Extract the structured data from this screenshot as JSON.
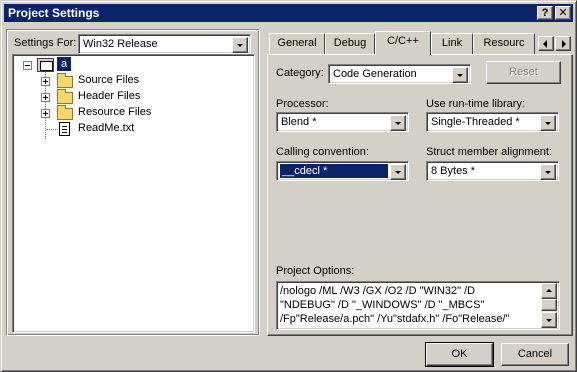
{
  "window": {
    "title": "Project Settings",
    "help_glyph": "?",
    "close_glyph": "✕"
  },
  "left": {
    "settings_for_label": "Settings For:",
    "settings_for_value": "Win32 Release",
    "tree": {
      "root": "a",
      "items": [
        {
          "label": "Source Files",
          "type": "folder"
        },
        {
          "label": "Header Files",
          "type": "folder"
        },
        {
          "label": "Resource Files",
          "type": "folder"
        },
        {
          "label": "ReadMe.txt",
          "type": "file"
        }
      ]
    }
  },
  "tabs": [
    "General",
    "Debug",
    "C/C++",
    "Link",
    "Resourc"
  ],
  "active_tab": "C/C++",
  "ccpp": {
    "category_label": "Category:",
    "category_value": "Code Generation",
    "reset_label": "Reset",
    "processor_label": "Processor:",
    "processor_value": "Blend *",
    "runtime_label": "Use run-time library:",
    "runtime_value": "Single-Threaded *",
    "calling_label": "Calling convention:",
    "calling_value": "__cdecl *",
    "struct_label": "Struct member alignment:",
    "struct_value": "8 Bytes *",
    "options_label": "Project Options:",
    "options_text": "/nologo /ML /W3 /GX /O2 /D \"WIN32\" /D\n\"NDEBUG\" /D \"_WINDOWS\" /D \"_MBCS\"\n/Fp\"Release/a.pch\" /Yu\"stdafx.h\" /Fo\"Release/\""
  },
  "buttons": {
    "ok": "OK",
    "cancel": "Cancel"
  }
}
